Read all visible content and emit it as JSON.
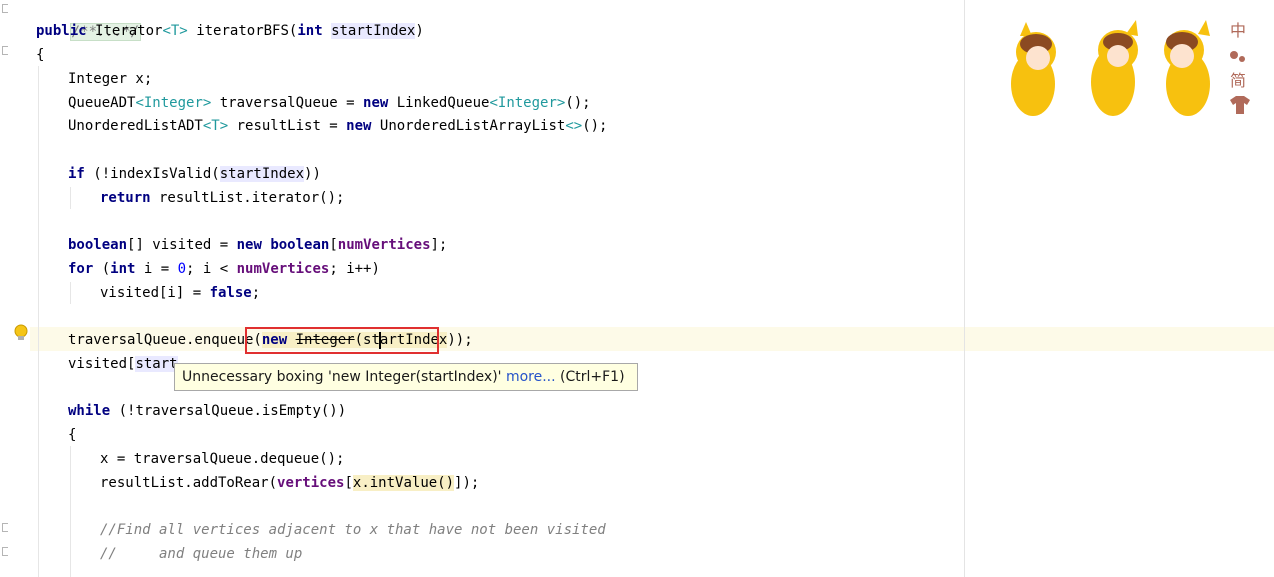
{
  "code": {
    "fold_comment": "/**...*/",
    "signature": {
      "kw_public": "public",
      "type": "Iterator",
      "generic": "<T>",
      "method": "iteratorBFS(",
      "kw_int": "int",
      "param": "startIndex",
      "close": ")"
    },
    "open_brace": "{",
    "decl_x": "Integer x;",
    "queue_decl": {
      "a": "QueueADT",
      "g1": "<Integer>",
      "b": " traversalQueue = ",
      "kw_new": "new",
      "c": " LinkedQueue",
      "g2": "<Integer>",
      "d": "();"
    },
    "list_decl": {
      "a": "UnorderedListADT",
      "g1": "<T>",
      "b": " resultList = ",
      "kw_new": "new",
      "c": " UnorderedListArrayList",
      "g2": "<>",
      "d": "();"
    },
    "if_line": {
      "kw": "if",
      "a": " (!indexIsValid(",
      "param": "startIndex",
      "b": "))"
    },
    "return_line": {
      "kw": "return",
      "a": " resultList.iterator();"
    },
    "visited_decl": {
      "kw1": "boolean",
      "a": "[] visited = ",
      "kw_new": "new",
      "kw2": "boolean",
      "b": "[",
      "field": "numVertices",
      "c": "];"
    },
    "for_line": {
      "kw": "for",
      "a": " (",
      "kw_int": "int",
      "b": " i = ",
      "num": "0",
      "c": "; i < ",
      "field": "numVertices",
      "d": "; i++)"
    },
    "visited_false": {
      "a": "visited[i] = ",
      "kw": "false",
      "b": ";"
    },
    "enqueue_line": {
      "a": "traversalQueue.enqueue(",
      "kw_new": "new",
      "strike": "Integer",
      "b": "(st",
      "c": "artIndex",
      "d": "));"
    },
    "visited_start": {
      "a": "visited[",
      "param": "start"
    },
    "while_line": {
      "kw": "while",
      "a": " (!traversalQueue.isEmpty())"
    },
    "inner_brace": "{",
    "dequeue_line": "x = traversalQueue.dequeue();",
    "add_line": {
      "a": "resultList.addToRear(",
      "field": "vertices",
      "b": "[",
      "c": "x.intValue()",
      "d": "]);"
    },
    "comment1": "//Find all vertices adjacent to x that have not been visited",
    "comment2": "//     and queue them up"
  },
  "tooltip": {
    "text": "Unnecessary boxing 'new Integer(startIndex)' ",
    "link": "more...",
    "shortcut": " (Ctrl+F1)"
  },
  "deco": {
    "ime_lang": "中",
    "ime_mode": "简"
  },
  "colors": {
    "keyword": "#000080",
    "field": "#660e7a",
    "generic": "#20999d",
    "number": "#0000ff",
    "comment": "#808080",
    "warning_box": "#e03030",
    "tooltip_bg": "#ffffe1",
    "link": "#2653c9"
  }
}
